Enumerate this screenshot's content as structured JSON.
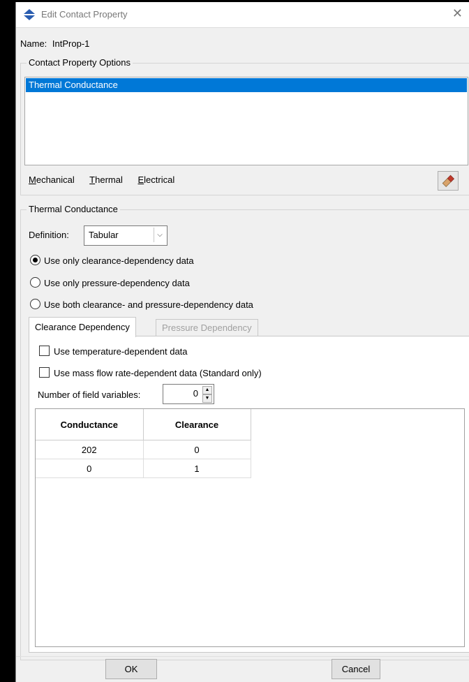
{
  "window": {
    "title": "Edit Contact Property",
    "close_glyph": "✕"
  },
  "name_row": {
    "label": "Name:",
    "value": "IntProp-1"
  },
  "options_group": {
    "title": "Contact Property Options",
    "list_items": [
      "Thermal Conductance"
    ],
    "selected_index": 0
  },
  "menubar": [
    {
      "accel": "M",
      "rest": "echanical"
    },
    {
      "accel": "T",
      "rest": "hermal"
    },
    {
      "accel": "E",
      "rest": "lectrical"
    }
  ],
  "thermal_group": {
    "title": "Thermal Conductance",
    "definition_label": "Definition:",
    "definition_value": "Tabular",
    "radios": [
      {
        "label": "Use only clearance-dependency data",
        "checked": true
      },
      {
        "label": "Use only pressure-dependency data",
        "checked": false
      },
      {
        "label": "Use both clearance- and pressure-dependency data",
        "checked": false
      }
    ]
  },
  "tabs": {
    "active": "Clearance Dependency",
    "inactive": "Pressure Dependency"
  },
  "clearance_panel": {
    "checkboxes": [
      {
        "label": "Use temperature-dependent data",
        "checked": false
      },
      {
        "label": "Use mass flow rate-dependent data (Standard only)",
        "checked": false
      }
    ],
    "field_vars_label": "Number of field variables:",
    "field_vars_value": "0",
    "table": {
      "headers": [
        "Conductance",
        "Clearance"
      ],
      "rows": [
        [
          "202",
          "0"
        ],
        [
          "0",
          "1"
        ]
      ]
    }
  },
  "buttons": {
    "ok": "OK",
    "cancel": "Cancel"
  },
  "colors": {
    "selection": "#0078d7",
    "app_icon": "#2a5db0"
  },
  "icons": [
    "app-icon",
    "close-icon",
    "eraser-icon",
    "dropdown-arrow-icon",
    "spin-up-icon",
    "spin-down-icon"
  ]
}
